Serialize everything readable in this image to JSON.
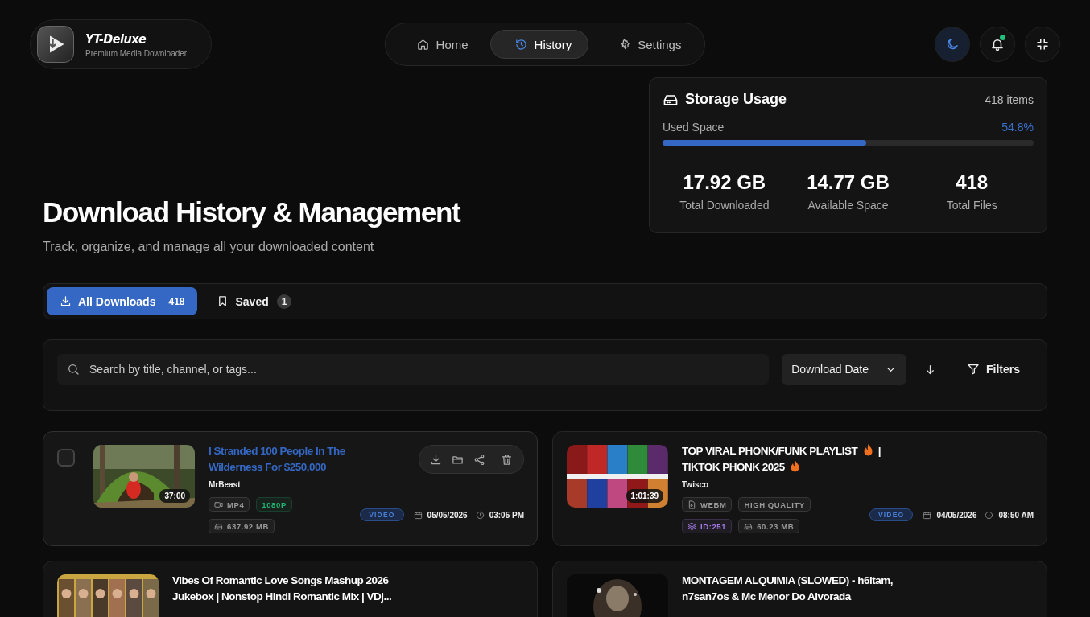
{
  "brand": {
    "name": "YT-Deluxe",
    "tagline": "Premium Media Downloader"
  },
  "nav": [
    {
      "label": "Home",
      "selected": false
    },
    {
      "label": "History",
      "selected": true
    },
    {
      "label": "Settings",
      "selected": false
    }
  ],
  "header_actions": [
    {
      "selected": true,
      "badge": false
    },
    {
      "selected": false,
      "badge": true
    },
    {
      "selected": false,
      "badge": false
    }
  ],
  "storage": {
    "title": "Storage Usage",
    "count": "418 items",
    "used_label": "Used Space",
    "used_percent": "54.8%",
    "level": 0.548,
    "stats": [
      {
        "value": "17.92 GB",
        "label": "Total Downloaded"
      },
      {
        "value": "14.77 GB",
        "label": "Available Space"
      },
      {
        "value": "418",
        "label": "Total Files"
      }
    ]
  },
  "hero": {
    "title": "Download History & Management",
    "subtitle": "Track, organize, and manage all your downloaded content"
  },
  "tabs": [
    {
      "label": "All Downloads",
      "count": "418",
      "selected": true
    },
    {
      "label": "Saved",
      "count": "1",
      "selected": false
    }
  ],
  "search": {
    "placeholder": "Search by title, channel, or tags...",
    "sort": "Download Date",
    "filters": "Filters"
  },
  "downloads": [
    {
      "hovered": true,
      "checked": false,
      "title": [
        {
          "kind": "text",
          "text": "I Stranded 100 People In The Wilderness For $250,000"
        }
      ],
      "channel": "MrBeast",
      "duration": "37:00",
      "badges": [
        {
          "kind": "format",
          "label": "MP4",
          "color": "#9a9a9a"
        },
        {
          "kind": "quality",
          "label": "1080P",
          "color": "#22b573"
        },
        {
          "kind": "size",
          "label": "637.92 MB",
          "color": "#9a9a9a"
        }
      ],
      "type": "VIDEO",
      "date": "05/05/2026",
      "time": "03:05 PM"
    },
    {
      "hovered": false,
      "checked": false,
      "title": [
        {
          "kind": "text",
          "text": "TOP VIRAL PHONK/FUNK PLAYLIST"
        },
        {
          "kind": "flame"
        },
        {
          "kind": "text",
          "text": "| TIKTOK PHONK 2025"
        },
        {
          "kind": "flame"
        }
      ],
      "channel": "Twisco",
      "duration": "1:01:39",
      "badges": [
        {
          "kind": "format",
          "label": "WEBM",
          "color": "#9a9a9a"
        },
        {
          "kind": "quality",
          "label": "HIGH QUALITY",
          "color": "#9a9a9a"
        },
        {
          "kind": "id",
          "label": "ID:251",
          "color": "#a77de8"
        },
        {
          "kind": "size",
          "label": "60.23 MB",
          "color": "#9a9a9a"
        }
      ],
      "type": "VIDEO",
      "date": "04/05/2026",
      "time": "08:50 AM"
    },
    {
      "hovered": false,
      "checked": false,
      "title": [
        {
          "kind": "text",
          "text": "Vibes Of Romantic Love Songs Mashup 2026 Jukebox | Nonstop Hindi Romantic Mix | VDj..."
        }
      ]
    },
    {
      "hovered": false,
      "checked": false,
      "title": [
        {
          "kind": "text",
          "text": "MONTAGEM ALQUIMIA (SLOWED) - h6itam, n7san7os & Mc Menor Do Alvorada"
        }
      ]
    }
  ]
}
